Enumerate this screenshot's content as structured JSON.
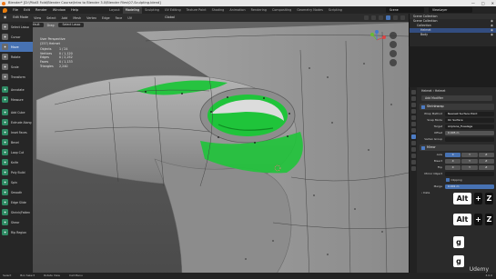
{
  "titlebar": {
    "text": "Blender* [D:\\Pilot3 Fold\\Blender Course\\Intro to Blender 3.0\\Blender Files\\07-Sculpting.blend]",
    "controls": [
      "—",
      "□",
      "✕"
    ]
  },
  "menubar": {
    "menus": [
      "File",
      "Edit",
      "Render",
      "Window",
      "Help"
    ],
    "workspaces": [
      "Layout",
      "Modeling",
      "Sculpting",
      "UV Editing",
      "Texture Paint",
      "Shading",
      "Animation",
      "Rendering",
      "Compositing",
      "Geometry Nodes",
      "Scripting"
    ],
    "active_workspace": "Modeling",
    "scene": "Scene",
    "view_layer": "ViewLayer"
  },
  "viewport": {
    "header": {
      "editor_icon": "3d-viewport-icon",
      "mode": "Edit Mode",
      "links": [
        "View",
        "Select",
        "Add",
        "Mesh",
        "Vertex",
        "Edge",
        "Face",
        "UV"
      ],
      "transform": "Global",
      "options": "Options"
    },
    "tool_header": {
      "tool": "Default",
      "drag": "Drag:",
      "drag_value": "Select Lasso"
    },
    "stats": {
      "title": "User Perspective",
      "subtitle": "(257) Helmet",
      "rows": [
        {
          "label": "Objects",
          "value": "1 / 24"
        },
        {
          "label": "Vertices",
          "value": "0 / 1,120"
        },
        {
          "label": "Edges",
          "value": "0 / 2,252"
        },
        {
          "label": "Faces",
          "value": "0 / 1,133"
        },
        {
          "label": "Triangles",
          "value": "2,240"
        }
      ]
    },
    "toolbox": [
      {
        "label": "Select Lasso",
        "icon": "lasso-icon",
        "active": false
      },
      {
        "label": "Cursor",
        "icon": "cursor-icon",
        "active": false
      },
      {
        "label": "Move",
        "icon": "move-icon",
        "active": true
      },
      {
        "label": "Rotate",
        "icon": "rotate-icon",
        "active": false
      },
      {
        "label": "Scale",
        "icon": "scale-icon",
        "active": false
      },
      {
        "label": "Transform",
        "icon": "transform-icon",
        "active": false
      },
      {
        "label": "Annotate",
        "icon": "annotate-icon",
        "active": false,
        "sep": true
      },
      {
        "label": "Measure",
        "icon": "measure-icon",
        "active": false
      },
      {
        "label": "Add Cube",
        "icon": "add-cube-icon",
        "active": false,
        "sep": true
      },
      {
        "label": "Extrude Along",
        "icon": "extrude-icon",
        "active": false
      },
      {
        "label": "Inset Faces",
        "icon": "inset-icon",
        "active": false
      },
      {
        "label": "Bevel",
        "icon": "bevel-icon",
        "active": false
      },
      {
        "label": "Loop Cut",
        "icon": "loop-cut-icon",
        "active": false
      },
      {
        "label": "Knife",
        "icon": "knife-icon",
        "active": false
      },
      {
        "label": "Poly Build",
        "icon": "poly-build-icon",
        "active": false
      },
      {
        "label": "Spin",
        "icon": "spin-icon",
        "active": false
      },
      {
        "label": "Smooth",
        "icon": "smooth-icon",
        "active": false
      },
      {
        "label": "Edge Slide",
        "icon": "edge-slide-icon",
        "active": false
      },
      {
        "label": "Shrink/Fatten",
        "icon": "shrink-fatten-icon",
        "active": false
      },
      {
        "label": "Shear",
        "icon": "shear-icon",
        "active": false
      },
      {
        "label": "Rip Region",
        "icon": "rip-region-icon",
        "active": false
      }
    ]
  },
  "outliner": {
    "header": "Scene Collection",
    "rows": [
      {
        "label": "Scene Collection",
        "selected": false
      },
      {
        "label": "Collection",
        "selected": false
      },
      {
        "label": "Helmet",
        "selected": true
      },
      {
        "label": "Body",
        "selected": false
      }
    ]
  },
  "properties": {
    "path": "Helmet  ›  Helmet",
    "add_modifier": "Add Modifier",
    "modifiers": [
      {
        "name": "Shrinkwrap",
        "rows": [
          {
            "label": "Wrap Method",
            "value": "Nearest Surface Point"
          },
          {
            "label": "Snap Mode",
            "value": "On Surface"
          },
          {
            "label": "Target",
            "value": "Airplane_Fuselage"
          },
          {
            "label": "Offset",
            "value": "0.005 m"
          }
        ],
        "vertex_group_label": "Vertex Group"
      },
      {
        "name": "Mirror",
        "axis_label": "Axis",
        "bisect_label": "Bisect",
        "flip_label": "Flip",
        "axes": [
          "X",
          "Y",
          "Z"
        ],
        "axis_on": [
          true,
          false,
          false
        ],
        "mirror_object_label": "Mirror Object",
        "clipping_label": "Clipping",
        "merge_label": "Merge",
        "merge_value": "0.001 m",
        "data_label": "Data"
      }
    ]
  },
  "keycast": [
    {
      "key": "Alt",
      "plus": "+",
      "mod": "Z"
    },
    {
      "key": "Alt",
      "plus": "+",
      "mod": "Z"
    },
    {
      "key": "g"
    },
    {
      "key": "g"
    }
  ],
  "footer": {
    "items": [
      "Select",
      "Box Select",
      "Rotate View",
      "Call Menu"
    ],
    "version": "3.0.0"
  },
  "watermark": "Udemy",
  "colors": {
    "accent": "#4772b3",
    "selection": "#1fc43a",
    "hull": "#9a9a9a",
    "background": "#5a5a5a"
  }
}
